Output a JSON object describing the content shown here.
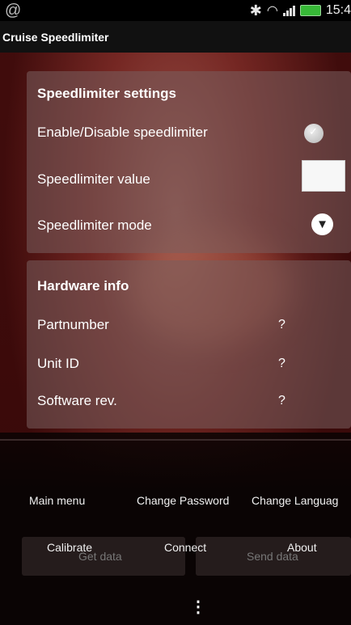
{
  "status_bar": {
    "app_icon": "app-icon",
    "time": "15:4"
  },
  "app": {
    "title": "Cruise Speedlimiter"
  },
  "settings_panel": {
    "heading": "Speedlimiter settings",
    "enable_label": "Enable/Disable speedlimiter",
    "enable_checked": true,
    "value_label": "Speedlimiter value",
    "value_field": "",
    "mode_label": "Speedlimiter mode"
  },
  "hardware_panel": {
    "heading": "Hardware info",
    "rows": [
      {
        "label": "Partnumber",
        "value": "?"
      },
      {
        "label": "Unit ID",
        "value": "?"
      },
      {
        "label": "Software rev.",
        "value": "?"
      }
    ]
  },
  "menu": {
    "top": [
      "Main menu",
      "Change Password",
      "Change Languag"
    ],
    "bottom": [
      "Calibrate",
      "Connect",
      "About"
    ]
  },
  "background_buttons": {
    "left": "Get data",
    "right": "Send data"
  },
  "colors": {
    "battery": "#37b837",
    "title_bg": "#111111",
    "panel": "#785f5f"
  }
}
